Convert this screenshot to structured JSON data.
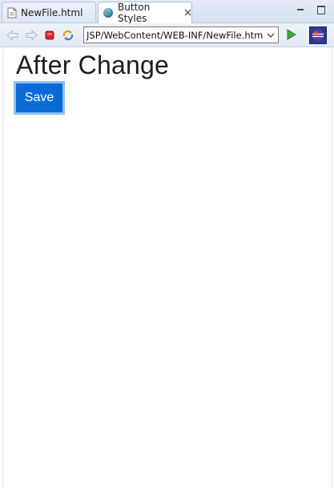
{
  "tabs": [
    {
      "label": "NewFile.html",
      "icon": "html-file-icon",
      "active": false
    },
    {
      "label": "Button Styles",
      "icon": "globe-icon",
      "active": true
    }
  ],
  "toolbar": {
    "url": "JSP/WebContent/WEB-INF/NewFile.html"
  },
  "page": {
    "heading": "After Change",
    "save_label": "Save"
  },
  "colors": {
    "button_bg": "#0a6bd6",
    "button_border": "#8ec1f1",
    "tab_strip": "#d6e2f1"
  }
}
